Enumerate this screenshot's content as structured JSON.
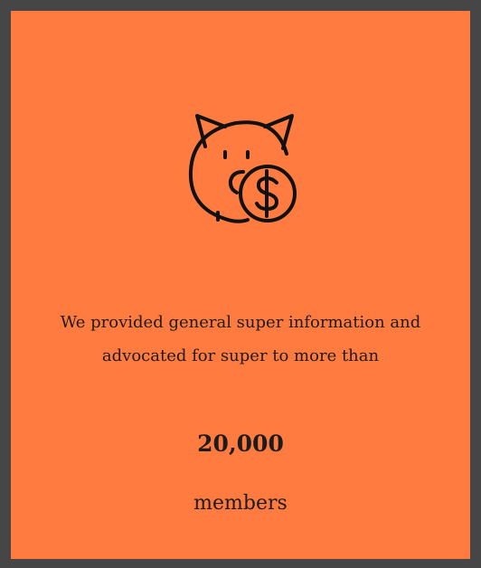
{
  "card": {
    "icon": "piggy-bank-dollar-icon",
    "description": "We provided general super information and advocated for super to more than",
    "stat_number": "20,000",
    "stat_label": "members"
  },
  "colors": {
    "background": "#FF7B3F",
    "frame": "#464646",
    "text": "#1c1c1c"
  }
}
